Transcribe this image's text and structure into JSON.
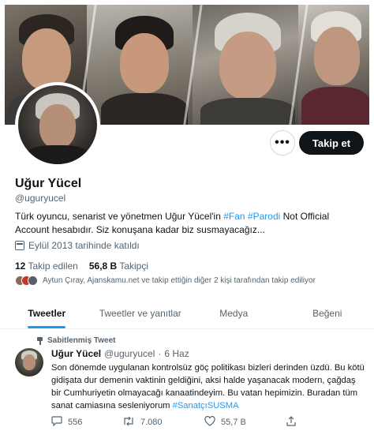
{
  "profile": {
    "name": "Uğur Yücel",
    "handle": "@uguryucel",
    "bio_prefix": "Türk oyuncu, senarist ve yönetmen Uğur Yücel'in",
    "bio_tag1": "#Fan",
    "bio_tag2": "#Parodi",
    "bio_suffix": "Not Official Account hesabıdır. Siz konuşana kadar biz susmayacağız...",
    "joined": "Eylül 2013 tarihinde katıldı",
    "following_count": "12",
    "following_label": "Takip edilen",
    "followers_count": "56,8 B",
    "followers_label": "Takipçi",
    "followed_by": "Aytun Çıray, Ajanskamu.net ve takip ettiğin diğer 2 kişi tarafından takip ediliyor"
  },
  "actions": {
    "more_label": "•••",
    "follow_label": "Takip et"
  },
  "tabs": [
    {
      "label": "Tweetler",
      "active": true
    },
    {
      "label": "Tweetler ve yanıtlar",
      "active": false
    },
    {
      "label": "Medya",
      "active": false
    },
    {
      "label": "Beğeni",
      "active": false
    }
  ],
  "tweet": {
    "pinned_label": "Sabitlenmiş Tweet",
    "author": "Uğur Yücel",
    "handle": "@uguryucel",
    "separator": "·",
    "date": "6 Haz",
    "text": "Son dönemde uygulanan kontrolsüz göç politikası bizleri derinden üzdü. Bu kötü gidişata dur demenin vaktinin geldiğini, aksi halde yaşanacak modern, çağdaş bir Cumhuriyetin olmayacağı kanaatindeyim. Bu vatan hepimizin. Buradan tüm sanat camiasına sesleniyorum",
    "hashtag": "#SanatçıSUSMA",
    "replies": "556",
    "retweets": "7.080",
    "likes": "55,7 B"
  },
  "icons": {
    "reply": "speech-bubble",
    "retweet": "retweet-arrows",
    "like": "heart",
    "share": "share-upload"
  },
  "colors": {
    "accent": "#1d9bf0",
    "follow_button": "#0f1419",
    "secondary_text": "#536471"
  }
}
